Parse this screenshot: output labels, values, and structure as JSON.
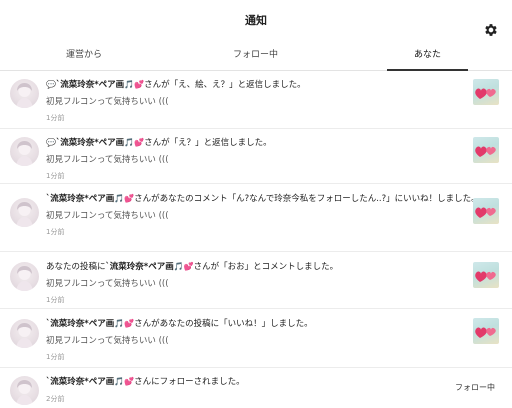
{
  "header": {
    "title": "通知"
  },
  "tabs": [
    {
      "label": "運営から"
    },
    {
      "label": "フォロー中"
    },
    {
      "label": "あなた",
      "active": true
    }
  ],
  "notifications": [
    {
      "prefix": "💬",
      "name": "`流菜玲奈*ペア画",
      "action": "さんが「え、絵、え？」と返信しました。",
      "body": "初見フルコンって気持ちいい (((",
      "time": "1分前",
      "has_thumb": true
    },
    {
      "prefix": "💬",
      "name": "`流菜玲奈*ペア画",
      "action": "さんが「え？」と返信しました。",
      "body": "初見フルコンって気持ちいい (((",
      "time": "1分前",
      "has_thumb": true
    },
    {
      "prefix": "",
      "name": "`流菜玲奈*ペア画",
      "action": "さんがあなたのコメント「ん?なんで玲奈今私をフォローしたん..?」にいいね！しました。",
      "body": "初見フルコンって気持ちいい (((",
      "time": "1分前",
      "has_thumb": true
    },
    {
      "prefix": "あなたの投稿に",
      "name": "`流菜玲奈*ペア画",
      "action": "さんが「おお」とコメントしました。",
      "body": "初見フルコンって気持ちいい (((",
      "time": "1分前",
      "has_thumb": true
    },
    {
      "prefix": "",
      "name": "`流菜玲奈*ペア画",
      "action": "さんがあなたの投稿に「いいね！」しました。",
      "body": "初見フルコンって気持ちいい (((",
      "time": "1分前",
      "has_thumb": true
    },
    {
      "prefix": "",
      "name": "`流菜玲奈*ペア画",
      "action": "さんにフォローされました。",
      "time": "2分前",
      "has_thumb": false,
      "button": "フォロー中"
    }
  ],
  "emoji": {
    "note": "🎵",
    "heart": "💕"
  },
  "icons": {
    "settings": "gear-icon"
  }
}
